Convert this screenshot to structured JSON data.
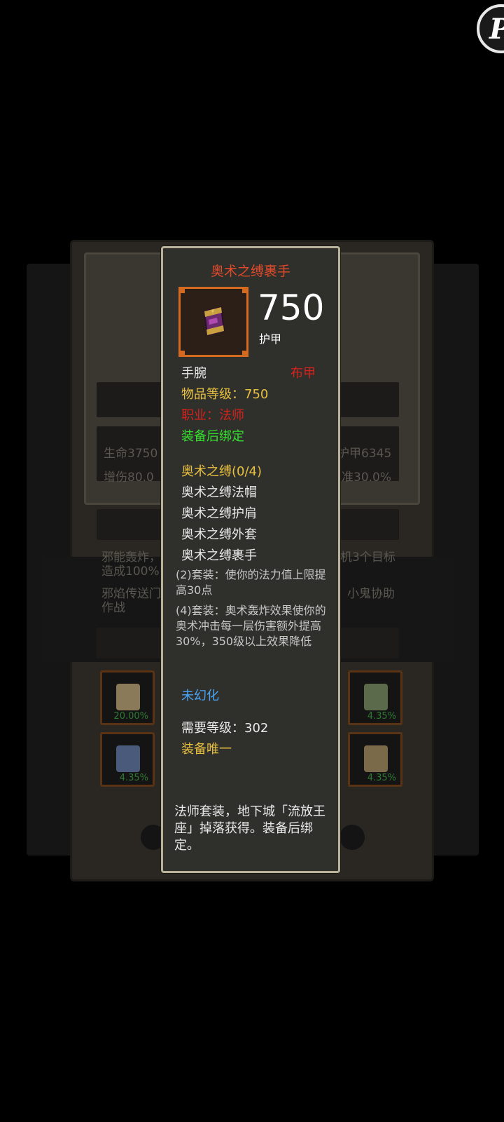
{
  "background_panel": {
    "stats": [
      "生命3750",
      "护甲6345",
      "增伤80.0",
      "准30.0%"
    ],
    "skill_texts": [
      "邪能轰炸，",
      "机3个目标",
      "造成100%",
      "邪焰传送门",
      "小鬼协助",
      "作战"
    ],
    "slots": [
      {
        "icon": "boots-icon",
        "percent": "20.00%"
      },
      {
        "icon": "gloves-icon",
        "percent": "4.35%"
      },
      {
        "icon": "scroll-icon",
        "percent": "4.35%"
      },
      {
        "icon": "bracer-icon",
        "percent": "4.35%"
      }
    ]
  },
  "tooltip": {
    "item_name": "奥术之缚裹手",
    "armor_value": "750",
    "armor_label": "护甲",
    "slot_type": "手腕",
    "armor_type": "布甲",
    "item_level": "物品等级：750",
    "class_requirement": "职业：法师",
    "bind_info": "装备后绑定",
    "set_name": "奥术之缚(0/4)",
    "set_items": [
      "奥术之缚法帽",
      "奥术之缚护肩",
      "奥术之缚外套",
      "奥术之缚裹手"
    ],
    "set_bonus_2": "(2)套装：使你的法力值上限提高30点",
    "set_bonus_4": "(4)套装：奥术轰炸效果使你的奥术冲击每一层伤害额外提高30%，350级以上效果降低",
    "transmog_status": "未幻化",
    "required_level": "需要等级：302",
    "unique_equipped": "装备唯一",
    "description": "法师套装，地下城「流放王座」掉落获得。装备后绑定。"
  },
  "colors": {
    "item_name": "#e04a2a",
    "gold_text": "#e8c040",
    "red_text": "#d8221c",
    "green_text": "#35e02e",
    "blue_text": "#4aa3f0",
    "tooltip_border": "#b9b19a",
    "icon_frame": "#d46a1f"
  },
  "icons": {
    "item_icon": "bracer-icon",
    "floating_button": "floating-assist-icon"
  }
}
